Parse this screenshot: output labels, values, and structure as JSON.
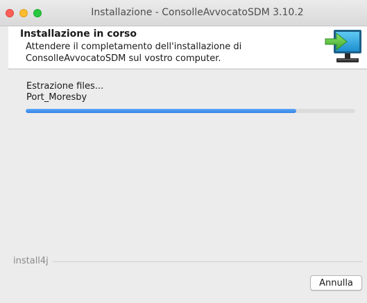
{
  "window": {
    "title": "Installazione - ConsolleAvvocatoSDM 3.10.2"
  },
  "header": {
    "title": "Installazione in corso",
    "description": "Attendere il completamento dell'installazione di ConsolleAvvocatoSDM sul vostro computer.",
    "icon": "computer-install-icon"
  },
  "status": {
    "action": "Estrazione files...",
    "current_file": "Port_Moresby"
  },
  "progress": {
    "fraction": 0.82
  },
  "footer": {
    "brand": "install4j",
    "cancel_label": "Annulla"
  },
  "colors": {
    "progress_fill": "#3b8ded",
    "close": "#fc5f57",
    "minimize": "#fdbc2e",
    "maximize": "#28c840"
  }
}
